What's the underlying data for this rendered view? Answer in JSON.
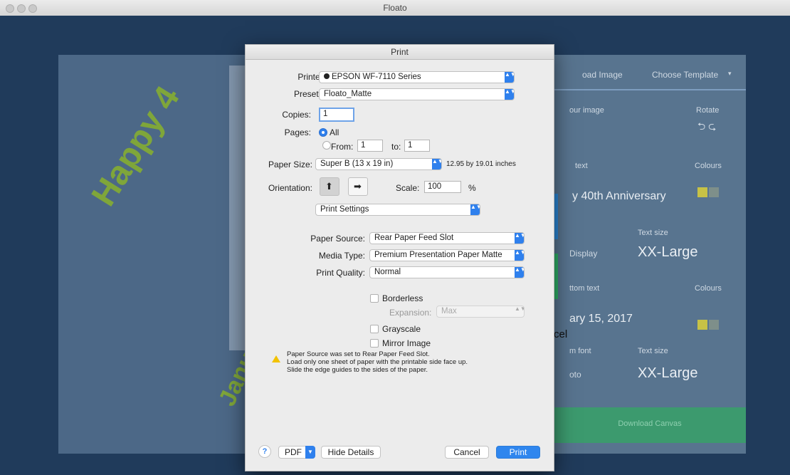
{
  "window": {
    "title": "Floato"
  },
  "background": {
    "canvas_text_top": "Happy 4",
    "canvas_text_bottom": "Janua",
    "tabs": {
      "upload": "oad Image",
      "template": "Choose Template"
    },
    "chevron_down": "▾",
    "labels": {
      "your_image": "our image",
      "rotate": "Rotate",
      "top_text": "text",
      "colours_top": "Colours",
      "text_size_top": "Text size",
      "font_top": "Display",
      "bottom_text": "ttom text",
      "colours_bottom": "Colours",
      "bottom_font": "m font",
      "text_size_bottom": "Text size",
      "font_bottom": "oto"
    },
    "values": {
      "top_text": "y 40th Anniversary",
      "top_size": "XX-Large",
      "bottom_text": "ary 15, 2017",
      "bottom_size": "XX-Large"
    },
    "cancel_fragment": "cel",
    "bottom_bar_label": "Download Canvas",
    "colors": {
      "swatch_yellow": "#c7c246",
      "swatch_gray": "#7e8f8a"
    }
  },
  "print_dialog": {
    "title": "Print",
    "printer_label": "Printer:",
    "printer_value": "EPSON WF-7110 Series",
    "presets_label": "Presets:",
    "presets_value": "Floato_Matte",
    "copies_label": "Copies:",
    "copies_value": "1",
    "pages_label": "Pages:",
    "pages_all": "All",
    "pages_from_label": "From:",
    "pages_from_value": "1",
    "pages_to_label": "to:",
    "pages_to_value": "1",
    "paper_size_label": "Paper Size:",
    "paper_size_value": "Super B (13 x 19 in)",
    "paper_size_info": "12.95 by 19.01 inches",
    "orientation_label": "Orientation:",
    "scale_label": "Scale:",
    "scale_value": "100",
    "scale_unit": "%",
    "section_value": "Print Settings",
    "paper_source_label": "Paper Source:",
    "paper_source_value": "Rear Paper Feed Slot",
    "media_type_label": "Media Type:",
    "media_type_value": "Premium Presentation Paper Matte",
    "print_quality_label": "Print Quality:",
    "print_quality_value": "Normal",
    "borderless_label": "Borderless",
    "expansion_label": "Expansion:",
    "expansion_value": "Max",
    "grayscale_label": "Grayscale",
    "mirror_label": "Mirror Image",
    "message_line1": "Paper Source was set to Rear Paper Feed Slot.",
    "message_line2": "Load only one sheet of paper with the printable side face up.",
    "message_line3": "Slide the edge guides to the sides of the paper.",
    "help_label": "?",
    "pdf_label": "PDF",
    "hide_details_label": "Hide Details",
    "cancel_label": "Cancel",
    "print_label": "Print",
    "updown_arrow": "▲▼"
  }
}
